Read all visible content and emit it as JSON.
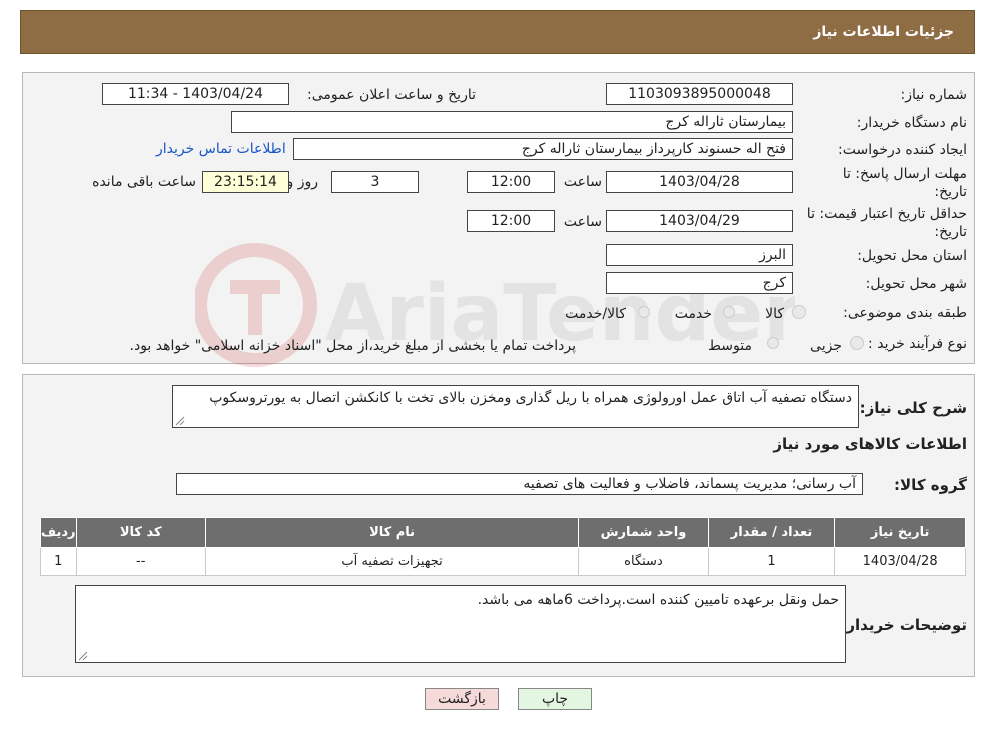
{
  "header": {
    "title": "جزئیات اطلاعات نیاز"
  },
  "form": {
    "need_number_label": "شماره نیاز:",
    "need_number": "1103093895000048",
    "announce_label": "تاریخ و ساعت اعلان عمومی:",
    "announce_value": "1403/04/24 - 11:34",
    "buyer_org_label": "نام دستگاه خریدار:",
    "buyer_org": "بیمارستان ثاراله کرج",
    "creator_label": "ایجاد کننده درخواست:",
    "creator": "فتح اله حسنوند کارپرداز بیمارستان ثاراله کرج",
    "contact_link": "اطلاعات تماس خریدار",
    "deadline_label_1": "مهلت ارسال پاسخ: تا",
    "deadline_label_2": "تاریخ:",
    "deadline_date": "1403/04/28",
    "time_label": "ساعت",
    "deadline_time": "12:00",
    "days_value": "3",
    "days_label": "روز و",
    "remaining_time": "23:15:14",
    "remaining_label": "ساعت باقی مانده",
    "validity_label_1": "حداقل تاریخ اعتبار قیمت: تا",
    "validity_label_2": "تاریخ:",
    "validity_date": "1403/04/29",
    "validity_time": "12:00",
    "province_label": "استان محل تحویل:",
    "province": "البرز",
    "city_label": "شهر محل تحویل:",
    "city": "کرج",
    "category_label": "طبقه بندی موضوعی:",
    "category_options": [
      "کالا",
      "خدمت",
      "کالا/خدمت"
    ],
    "process_label": "نوع فرآیند خرید :",
    "process_options": [
      "جزیی",
      "متوسط"
    ],
    "process_note": "پرداخت تمام یا بخشی از مبلغ خرید،از محل \"اسناد خزانه اسلامی\" خواهد بود."
  },
  "details": {
    "general_label": "شرح کلی نیاز:",
    "general_text": "دستگاه تصفیه آب اتاق عمل اورولوژی همراه با ریل گذاری ومخزن بالای تخت با کانکشن اتصال به یورتروسکوپ",
    "goods_info_title": "اطلاعات کالاهای مورد نیاز",
    "group_label": "گروه کالا:",
    "group_value": "آب رسانی؛ مدیریت پسماند، فاضلاب و فعالیت های تصفیه",
    "table": {
      "headers": [
        "ردیف",
        "کد کالا",
        "نام کالا",
        "واحد شمارش",
        "تعداد / مقدار",
        "تاریخ نیاز"
      ],
      "rows": [
        [
          "1",
          "--",
          "تجهیزات تصفیه آب",
          "دستگاه",
          "1",
          "1403/04/28"
        ]
      ]
    },
    "buyer_notes_label": "توضیحات خریدار:",
    "buyer_notes": "حمل ونقل برعهده تامیین کننده است.پرداخت 6ماهه می باشد."
  },
  "buttons": {
    "print": "چاپ",
    "back": "بازگشت"
  },
  "watermark": {
    "text": "AriaTender.neT"
  },
  "colors": {
    "header": "#8e6d45",
    "back_button": "#f6dada",
    "print_button": "#e2f6e2",
    "table_header": "#6e6e6e",
    "link": "#1a55c8"
  }
}
